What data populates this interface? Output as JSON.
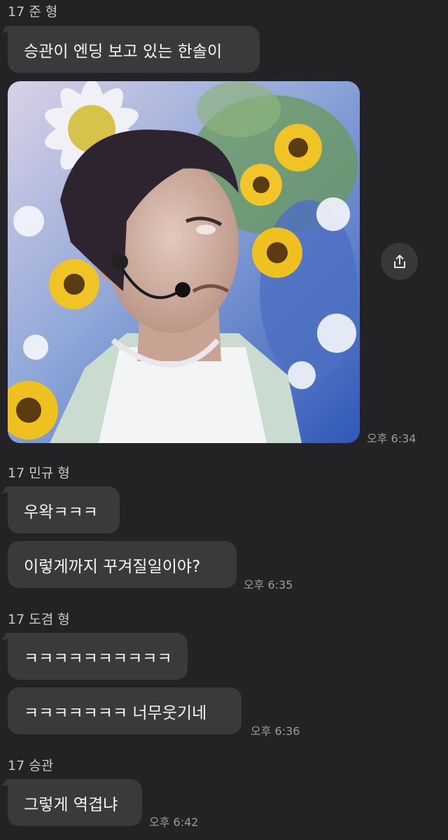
{
  "messages": {
    "m1": {
      "sender": "17 준 형",
      "text": "승관이 엔딩 보고 있는 한솔이",
      "time": "오후 6:34"
    },
    "m2": {
      "sender": "17 민규 형",
      "line1": "우왁ㅋㅋㅋ",
      "line2": "이렇게까지 꾸겨질일이야?",
      "time": "오후 6:35"
    },
    "m3": {
      "sender": "17 도겸 형",
      "line1": "ㅋㅋㅋㅋㅋㅋㅋㅋㅋㅋ",
      "line2": "ㅋㅋㅋㅋㅋㅋㅋ 너무웃기네",
      "time": "오후 6:36"
    },
    "m4": {
      "sender": "17 승관",
      "text": "그렇게 역겹냐",
      "time": "오후 6:42"
    }
  },
  "icons": {
    "share": "share-icon"
  },
  "colors": {
    "background": "#232325",
    "bubble": "#3a3a3d",
    "text": "#f4f4f4",
    "meta": "#9c9c9c"
  }
}
